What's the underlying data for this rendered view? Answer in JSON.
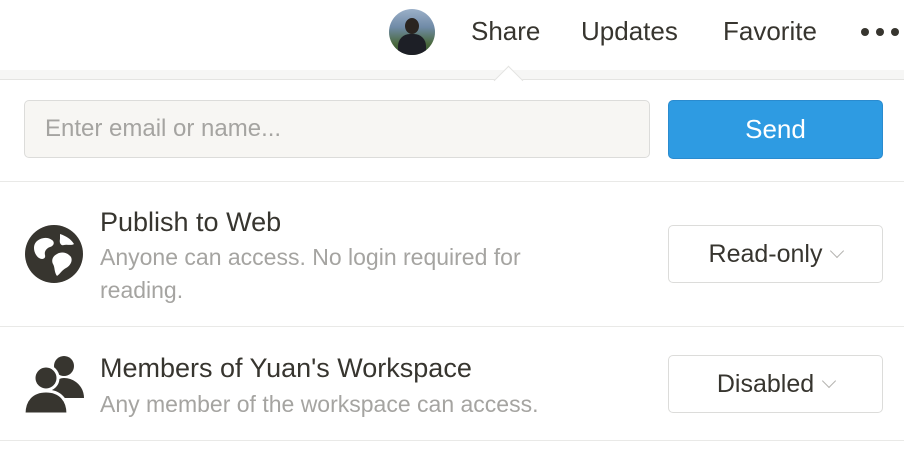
{
  "topbar": {
    "nav": {
      "share": "Share",
      "updates": "Updates",
      "favorite": "Favorite"
    },
    "more_icon": "more-dots-icon"
  },
  "share_panel": {
    "email_input": {
      "placeholder": "Enter email or name...",
      "value": ""
    },
    "send_label": "Send",
    "rows": [
      {
        "icon": "globe-icon",
        "title": "Publish to Web",
        "description": "Anyone can access. No login required for reading.",
        "permission": "Read-only"
      },
      {
        "icon": "members-icon",
        "title": "Members of Yuan's Workspace",
        "description": "Any member of the workspace can access.",
        "permission": "Disabled"
      }
    ]
  },
  "colors": {
    "accent": "#2e9be2",
    "text": "#37352f",
    "muted_text": "#a5a4a1"
  }
}
